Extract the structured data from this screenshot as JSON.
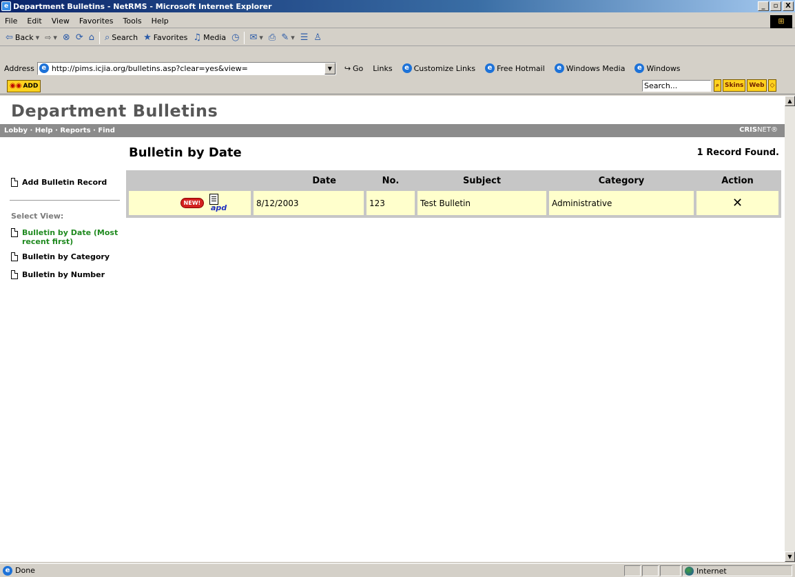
{
  "window": {
    "title": "Department Bulletins - NetRMS - Microsoft Internet Explorer",
    "controls": [
      "_",
      "▫",
      "X"
    ]
  },
  "menu": [
    "File",
    "Edit",
    "View",
    "Favorites",
    "Tools",
    "Help"
  ],
  "toolbar": {
    "back": "Back",
    "search": "Search",
    "favorites": "Favorites",
    "media": "Media"
  },
  "address": {
    "label": "Address",
    "url": "http://pims.icjia.org/bulletins.asp?clear=yes&view=",
    "go": "Go"
  },
  "links": {
    "label": "Links",
    "items": [
      "Customize Links",
      "Free Hotmail",
      "Windows Media",
      "Windows"
    ]
  },
  "plugin": {
    "add_label": "ADD",
    "search_placeholder": "Search...",
    "skins_label": "Skins",
    "web_label": "Web"
  },
  "page": {
    "title": "Department Bulletins",
    "nav": [
      "Lobby",
      "Help",
      "Reports",
      "Find"
    ],
    "brand_bold": "CRIS",
    "brand_thin": "NET®",
    "section_title": "Bulletin by Date",
    "record_count": "1 Record Found."
  },
  "sidebar": {
    "add_record": "Add Bulletin Record",
    "select_view_label": "Select View:",
    "views": [
      {
        "label": "Bulletin by Date (Most recent first)",
        "active": true
      },
      {
        "label": "Bulletin by Category",
        "active": false
      },
      {
        "label": "Bulletin by Number",
        "active": false
      }
    ]
  },
  "table": {
    "headers": [
      "",
      "Date",
      "No.",
      "Subject",
      "Category",
      "Action"
    ],
    "rows": [
      {
        "badge": "NEW!",
        "icon_label": "apd",
        "date": "8/12/2003",
        "number": "123",
        "subject": "Test Bulletin",
        "category": "Administrative",
        "action": "✕"
      }
    ]
  },
  "status": {
    "text": "Done",
    "zone": "Internet"
  },
  "colors": {
    "active_view": "#1f8a1f",
    "row_bg": "#ffffcc",
    "nav_strip": "#8c8c8c"
  }
}
